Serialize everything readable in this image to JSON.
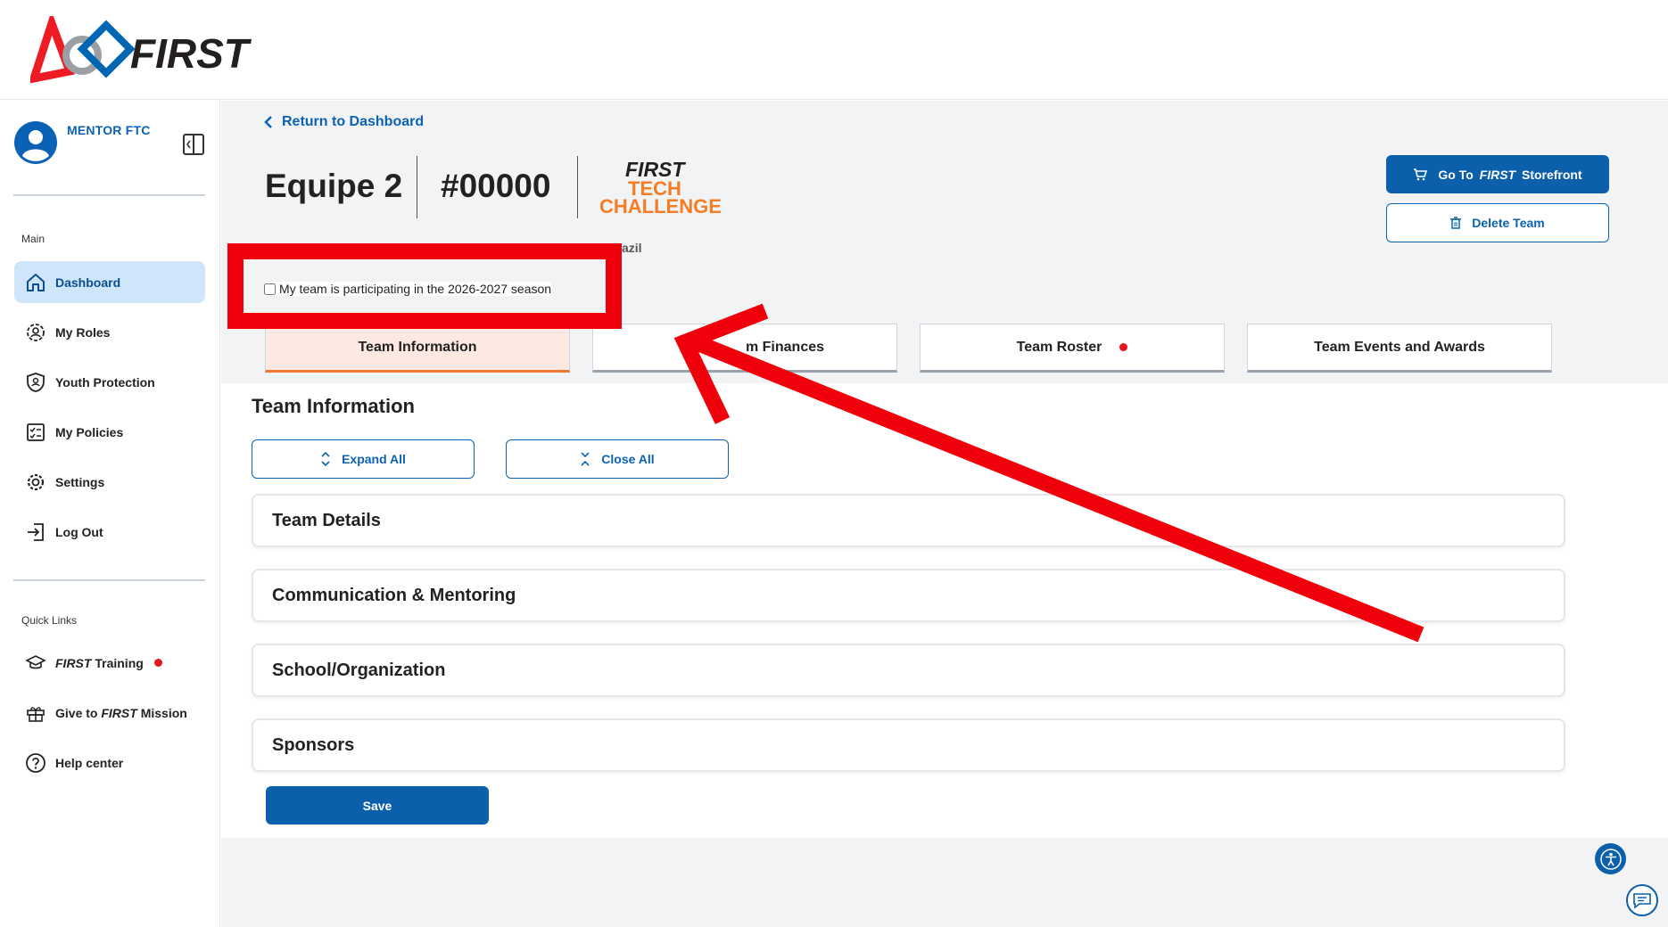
{
  "header": {
    "logo_text": "FIRST"
  },
  "sidebar": {
    "user_name": "MENTOR FTC",
    "main_label": "Main",
    "quick_links_label": "Quick Links",
    "main_items": [
      {
        "label": "Dashboard",
        "icon": "home-icon",
        "active": true
      },
      {
        "label": "My Roles",
        "icon": "roles-icon"
      },
      {
        "label": "Youth Protection",
        "icon": "shield-icon"
      },
      {
        "label": "My Policies",
        "icon": "checklist-icon"
      },
      {
        "label": "Settings",
        "icon": "gear-icon"
      },
      {
        "label": "Log Out",
        "icon": "logout-icon"
      }
    ],
    "quick_links": [
      {
        "brand": "FIRST",
        "label": " Training",
        "icon": "graduation-cap-icon",
        "has_notification": true
      },
      {
        "prefix": "Give to ",
        "brand": "FIRST",
        "label": " Mission",
        "icon": "gift-icon"
      },
      {
        "label": "Help center",
        "icon": "help-icon"
      }
    ]
  },
  "page": {
    "back_link": "Return to Dashboard",
    "team_name": "Equipe 2",
    "team_number": "#00000",
    "program_logo": {
      "line1": "FIRST",
      "line2": "TECH",
      "line3": "CHALLENGE"
    },
    "country_fragment": "azil",
    "storefront_button": {
      "prefix": "Go To ",
      "brand": "FIRST",
      "suffix": " Storefront"
    },
    "delete_button": "Delete Team",
    "participation_checkbox": {
      "label": "My team is participating in the 2026-2027 season",
      "checked": false
    }
  },
  "tabs": [
    {
      "label": "Team Information",
      "active": true
    },
    {
      "label": "m Finances"
    },
    {
      "label": "Team Roster",
      "has_notification": true
    },
    {
      "label": "Team Events and Awards"
    }
  ],
  "team_info": {
    "title": "Team Information",
    "expand_all": "Expand All",
    "close_all": "Close All",
    "sections": [
      "Team Details",
      "Communication & Mentoring",
      "School/Organization",
      "Sponsors"
    ],
    "save_button": "Save"
  },
  "colors": {
    "brand_blue": "#0b5fab",
    "link_blue": "#0b62b4",
    "active_nav": "#cfe5fa",
    "active_tab": "#fde9e1",
    "tab_accent": "#f0792f",
    "annotation_red": "#f0000a",
    "notification_red": "#e4151c",
    "ftc_orange": "#f57e25"
  }
}
